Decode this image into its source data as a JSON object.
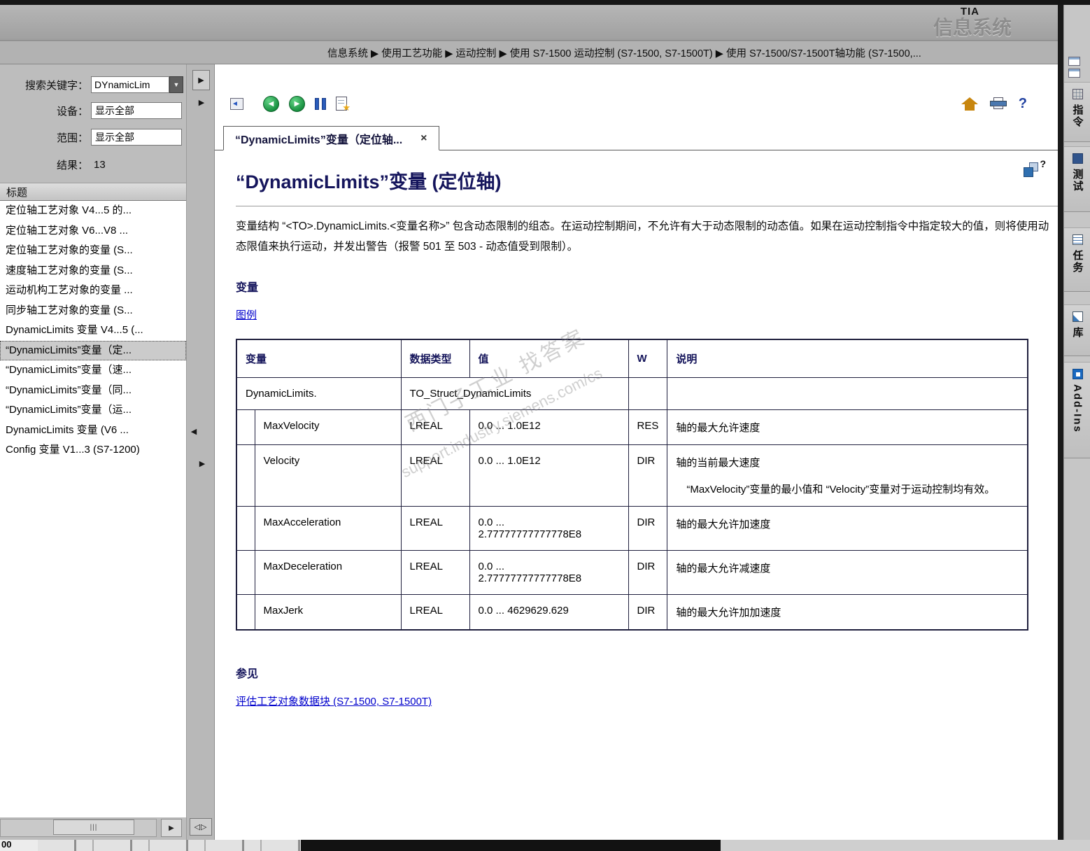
{
  "brand": {
    "tia": "TIA",
    "name": "信息系统"
  },
  "breadcrumb": "信息系统 ▶ 使用工艺功能 ▶ 运动控制 ▶ 使用 S7-1500 运动控制 (S7-1500, S7-1500T) ▶ 使用 S7-1500/S7-1500T轴功能 (S7-1500,...",
  "search_panel": {
    "keyword_label": "搜索关键字：",
    "keyword_value": "DYnamicLim",
    "device_label": "设备：",
    "device_value": "显示全部",
    "scope_label": "范围：",
    "scope_value": "显示全部",
    "result_label": "结果：",
    "result_count": "13",
    "list_header": "标题",
    "selected_index": 7,
    "results": [
      "定位轴工艺对象 V4...5 的...",
      "定位轴工艺对象 V6...V8 ...",
      "定位轴工艺对象的变量 (S...",
      "速度轴工艺对象的变量 (S...",
      "运动机构工艺对象的变量 ...",
      "同步轴工艺对象的变量 (S...",
      "DynamicLimits 变量 V4...5 (...",
      "“DynamicLimits”变量（定...",
      "“DynamicLimits”变量（速...",
      "“DynamicLimits”变量（同...",
      "“DynamicLimits”变量（运...",
      "DynamicLimits 变量 (V6 ...",
      "Config 变量 V1...3 (S7-1200)"
    ]
  },
  "toolbar": {
    "help_label": "?"
  },
  "tab": {
    "title": "“DynamicLimits”变量（定位轴...",
    "close": "×"
  },
  "content": {
    "title": "“DynamicLimits”变量 (定位轴)",
    "intro": "变量结构 “<TO>.DynamicLimits.<变量名称>” 包含动态限制的组态。在运动控制期间，不允许有大于动态限制的动态值。如果在运动控制指令中指定较大的值，则将使用动态限值来执行运动，并发出警告（报警 501 至 503 - 动态值受到限制）。",
    "variables_heading": "变量",
    "legend_link": "图例",
    "table": {
      "headers": [
        "变量",
        "数据类型",
        "值",
        "W",
        "说明"
      ],
      "rows": [
        {
          "struct": true,
          "name": "DynamicLimits.",
          "type": "TO_Struct_DynamicLimits"
        },
        {
          "name": "MaxVelocity",
          "type": "LREAL",
          "value": "0.0 ... 1.0E12",
          "w": "RES",
          "desc": "轴的最大允许速度"
        },
        {
          "name": "Velocity",
          "type": "LREAL",
          "value": "0.0 ... 1.0E12",
          "w": "DIR",
          "desc": "轴的当前最大速度\n\n　“MaxVelocity”变量的最小值和 “Velocity”变量对于运动控制均有效。"
        },
        {
          "name": "MaxAcceleration",
          "type": "LREAL",
          "value": "0.0 ...\n2.77777777777778E8",
          "w": "DIR",
          "desc": "轴的最大允许加速度"
        },
        {
          "name": "MaxDeceleration",
          "type": "LREAL",
          "value": "0.0 ...\n2.77777777777778E8",
          "w": "DIR",
          "desc": "轴的最大允许减速度"
        },
        {
          "name": "MaxJerk",
          "type": "LREAL",
          "value": "0.0 ... 4629629.629",
          "w": "DIR",
          "desc": "轴的最大允许加加速度"
        }
      ]
    },
    "see_also_heading": "参见",
    "see_also_link": "评估工艺对象数据块 (S7-1500, S7-1500T)",
    "watermark_line1": "西门子工业  找答案",
    "watermark_line2": "support.industry.siemens.com/cs"
  },
  "right_tabs": [
    {
      "label": "指令"
    },
    {
      "label": "测试"
    },
    {
      "label": "任务"
    },
    {
      "label": "库"
    },
    {
      "label": "Add-Ins"
    }
  ],
  "bottom_bar": {
    "fragment": "00"
  }
}
